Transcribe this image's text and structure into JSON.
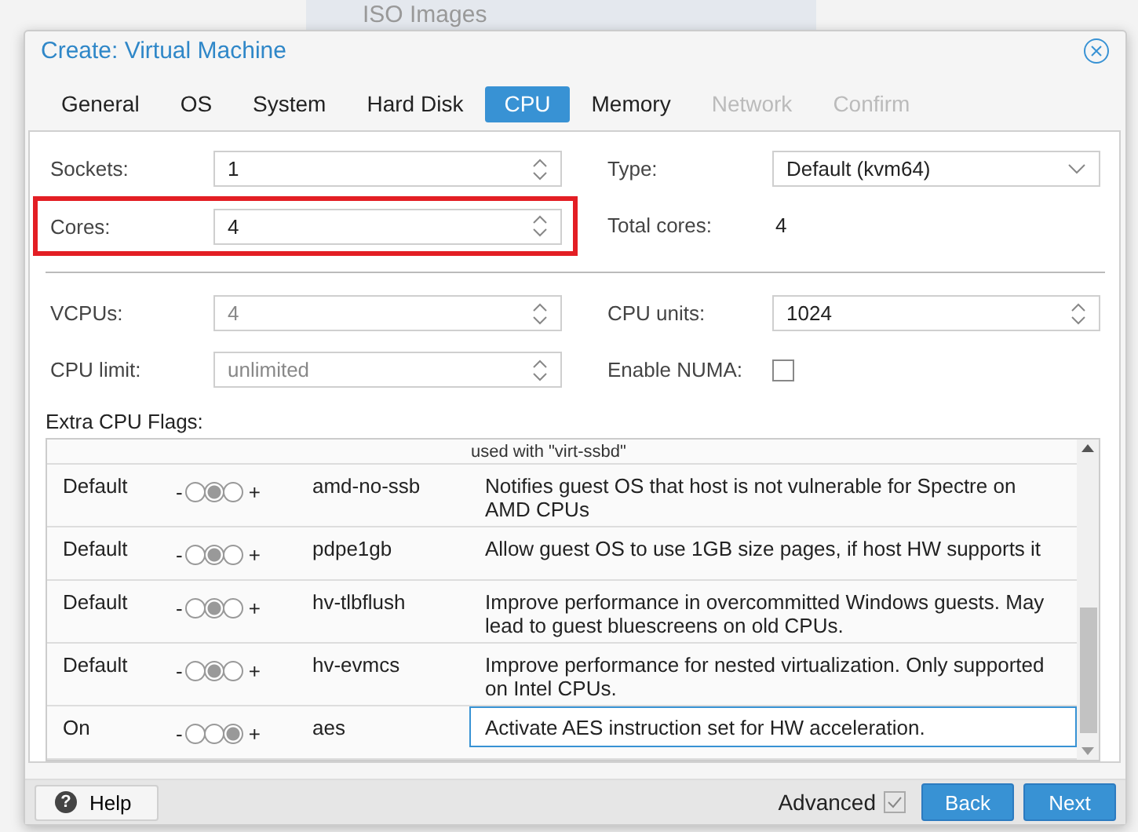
{
  "background": {
    "item": "ISO Images"
  },
  "window": {
    "title": "Create: Virtual Machine"
  },
  "tabs": [
    {
      "label": "General",
      "selected": false,
      "disabled": false
    },
    {
      "label": "OS",
      "selected": false,
      "disabled": false
    },
    {
      "label": "System",
      "selected": false,
      "disabled": false
    },
    {
      "label": "Hard Disk",
      "selected": false,
      "disabled": false
    },
    {
      "label": "CPU",
      "selected": true,
      "disabled": false
    },
    {
      "label": "Memory",
      "selected": false,
      "disabled": false
    },
    {
      "label": "Network",
      "selected": false,
      "disabled": true
    },
    {
      "label": "Confirm",
      "selected": false,
      "disabled": true
    }
  ],
  "top_rows": [
    {
      "left": {
        "label": "Sockets:",
        "value": "1",
        "kind": "spinner",
        "disabled": false
      },
      "right": {
        "label": "Type:",
        "value": "Default (kvm64)",
        "kind": "dropdown"
      },
      "highlighted": false
    },
    {
      "left": {
        "label": "Cores:",
        "value": "4",
        "kind": "spinner",
        "disabled": false
      },
      "right": {
        "label": "Total cores:",
        "value": "4",
        "kind": "text"
      },
      "highlighted": true
    }
  ],
  "bottom_rows": [
    {
      "left": {
        "label": "VCPUs:",
        "value": "4",
        "kind": "spinner",
        "disabled": true
      },
      "right": {
        "label": "CPU units:",
        "value": "1024",
        "kind": "spinner",
        "disabled": false
      },
      "highlighted": false
    },
    {
      "left": {
        "label": "CPU limit:",
        "value": "unlimited",
        "kind": "spinner",
        "disabled": true
      },
      "right": {
        "label": "Enable NUMA:",
        "kind": "checkbox",
        "checked": false
      },
      "highlighted": false
    }
  ],
  "flags": {
    "label": "Extra CPU Flags:",
    "partial_row": {
      "description": "used with \"virt-ssbd\""
    },
    "rows": [
      {
        "value": "Default",
        "minus": "-",
        "plus": "+",
        "radios": [
          {
            "selected": false
          },
          {
            "selected": true
          },
          {
            "selected": false
          }
        ],
        "name": "amd-no-ssb",
        "description": "Notifies guest OS that host is not vulnerable for Spectre on AMD CPUs",
        "focused": false
      },
      {
        "value": "Default",
        "minus": "-",
        "plus": "+",
        "radios": [
          {
            "selected": false
          },
          {
            "selected": true
          },
          {
            "selected": false
          }
        ],
        "name": "pdpe1gb",
        "description": "Allow guest OS to use 1GB size pages, if host HW supports it",
        "focused": false
      },
      {
        "value": "Default",
        "minus": "-",
        "plus": "+",
        "radios": [
          {
            "selected": false
          },
          {
            "selected": true
          },
          {
            "selected": false
          }
        ],
        "name": "hv-tlbflush",
        "description": "Improve performance in overcommitted Windows guests. May lead to guest bluescreens on old CPUs.",
        "focused": false
      },
      {
        "value": "Default",
        "minus": "-",
        "plus": "+",
        "radios": [
          {
            "selected": false
          },
          {
            "selected": true
          },
          {
            "selected": false
          }
        ],
        "name": "hv-evmcs",
        "description": "Improve performance for nested virtualization. Only supported on Intel CPUs.",
        "focused": false
      },
      {
        "value": "On",
        "minus": "-",
        "plus": "+",
        "radios": [
          {
            "selected": false
          },
          {
            "selected": false
          },
          {
            "selected": true
          }
        ],
        "name": "aes",
        "description": "Activate AES instruction set for HW acceleration.",
        "focused": true
      }
    ]
  },
  "footer": {
    "help_icon": "?",
    "help": "Help",
    "advanced": {
      "label": "Advanced",
      "checked": true
    },
    "buttons": [
      "Back",
      "Next"
    ]
  }
}
